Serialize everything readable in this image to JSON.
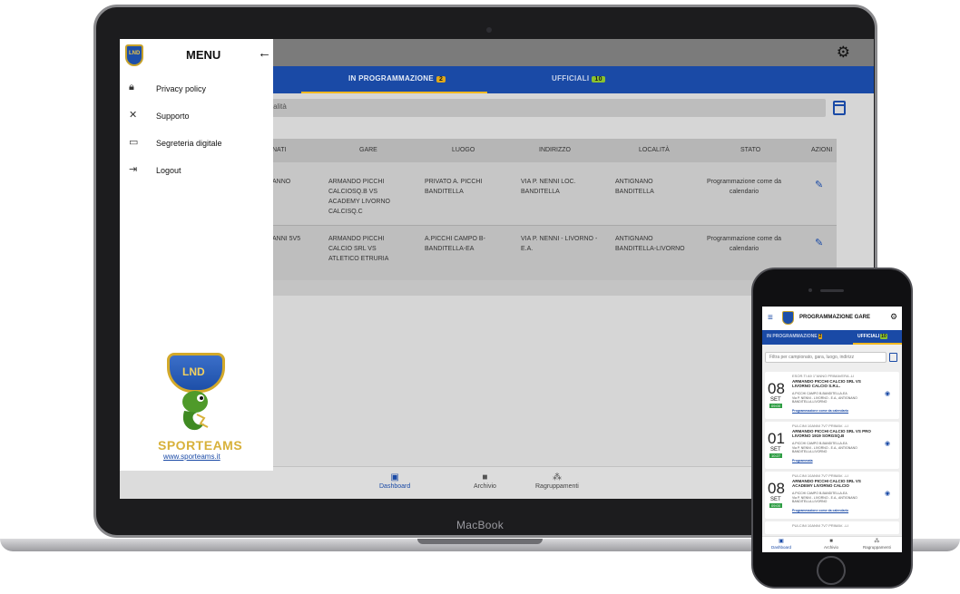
{
  "laptop": {
    "brand": "MacBook",
    "app": {
      "settings_icon": "gear-icon",
      "tabs": [
        {
          "label": "IN PROGRAMMAZIONE",
          "count": "2"
        },
        {
          "label": "UFFICIALI",
          "count": "10"
        }
      ],
      "search_placeholder_visible": "à, località",
      "table": {
        "headers": [
          "NATI",
          "GARE",
          "LUOGO",
          "INDIRIZZO",
          "LOCALITÀ",
          "STATO",
          "AZIONI"
        ],
        "rows": [
          {
            "campionato": "ANNO",
            "gara": "ARMANDO PICCHI CALCIOSQ.B VS ACADEMY LIVORNO CALCISQ.C",
            "luogo": "PRIVATO A. PICCHI BANDITELLA",
            "indirizzo": "VIA P. NENNI LOC. BANDITELLA",
            "localita": "ANTIGNANO BANDITELLA",
            "stato": "Programmazione come da calendario"
          },
          {
            "campionato": "ANNI 5V5",
            "gara": "ARMANDO PICCHI CALCIO SRL VS ATLETICO ETRURIA",
            "luogo": "A.PICCHI CAMPO B-BANDITELLA-EA",
            "indirizzo": "VIA P. NENNI - LIVORNO - E.A.",
            "localita": "ANTIGNANO BANDITELLA-LIVORNO",
            "stato": "Programmazione come da calendario"
          }
        ]
      },
      "bottom_nav": [
        {
          "label": "Dashboard",
          "icon": "calendar-icon"
        },
        {
          "label": "Archivio",
          "icon": "folder-icon"
        },
        {
          "label": "Ragruppamenti",
          "icon": "group-icon"
        }
      ],
      "drawer": {
        "logo_text": "LND",
        "title": "MENU",
        "items": [
          {
            "label": "Privacy policy",
            "icon": "lock-icon"
          },
          {
            "label": "Supporto",
            "icon": "tools-icon"
          },
          {
            "label": "Segreteria digitale",
            "icon": "monitor-icon"
          },
          {
            "label": "Logout",
            "icon": "logout-icon"
          }
        ],
        "sporteams_logo_text": "LND",
        "sporteams_word": "SPORTEAMS",
        "sporteams_link": "www.sporteams.it"
      }
    }
  },
  "phone": {
    "header_title": "PROGRAMMAZIONE GARE",
    "tabs": [
      {
        "label": "IN PROGRAMMAZIONE",
        "count": "2"
      },
      {
        "label": "UFFICIALI",
        "count": "10"
      }
    ],
    "search_placeholder": "Filtra per campionato, gara, luogo, indirizz",
    "cards": [
      {
        "day": "08",
        "month": "SET",
        "time": "09:00",
        "category": "ESOR.TI A9 1°ANNO PRIMAVERA -LI",
        "match": "ARMANDO PICCHI CALCIO SRL VS LIVORNO CALCIO S.R.L.",
        "location": "A.PICCHI CAMPO B-BANDITELLA-EA",
        "address": "Via P. NENNI - LIVORNO - E.A., ANTIGNANO BANDITELLA-LIVORNO",
        "stato": "Programmazione come da calendario"
      },
      {
        "day": "01",
        "month": "SET",
        "time": "10:27",
        "category": "PULCINI 10ANNI 7V7 PRIMAV. -LI",
        "match": "ARMANDO PICCHI CALCIO SRL VS PRO LIVORNO 1919 SORGSQ.B",
        "location": "A.PICCHI CAMPO B-BANDITELLA-EA",
        "address": "Via P. NENNI - LIVORNO - E.A., ANTIGNANO BANDITELLA-LIVORNO",
        "stato": "Programmata"
      },
      {
        "day": "08",
        "month": "SET",
        "time": "09:00",
        "category": "PULCINI 10ANNI 7V7 PRIMAV. -LI",
        "match": "ARMANDO PICCHI CALCIO SRL VS ACADEMY LIVORNO CALCIO",
        "location": "A.PICCHI CAMPO B-BANDITELLA-EA",
        "address": "Via P. NENNI - LIVORNO - E.A., ANTIGNANO BANDITELLA-LIVORNO",
        "stato": "Programmazione come da calendario"
      }
    ],
    "partial_card_category": "PULCINI 10ANNI 7V7 PRIMAV. -LI",
    "bottom_nav": [
      {
        "label": "Dashboard"
      },
      {
        "label": "Archivio"
      },
      {
        "label": "Ragruppamenti"
      }
    ]
  },
  "colors": {
    "primary": "#1a4aa6",
    "accent": "#f2b820",
    "count_yellow": "#e0a81a",
    "count_green": "#8ac22e"
  }
}
